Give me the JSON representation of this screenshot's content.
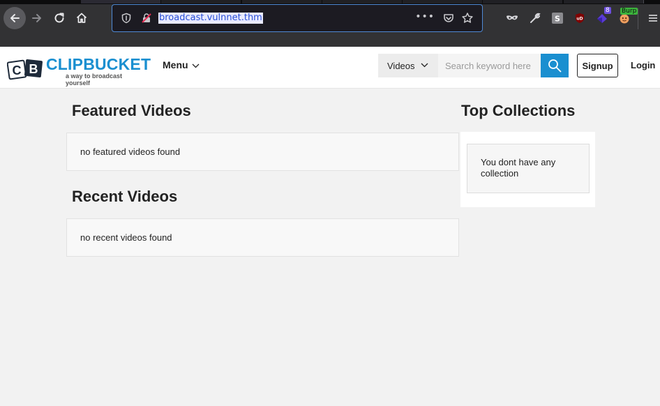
{
  "browser": {
    "url": "broadcast.vulnnet.thm",
    "more_label": "•••",
    "extensions": {
      "badge_count": "8",
      "burp_label": "Burp"
    }
  },
  "site": {
    "brand": "CLIPBUCKET",
    "tagline": "a way to broadcast yourself",
    "logo_letters": "CB",
    "menu_label": "Menu",
    "search": {
      "type_selected": "Videos",
      "placeholder": "Search keyword here"
    },
    "signup_label": "Signup",
    "login_label": "Login",
    "accent_color": "#1a8fd0"
  },
  "main": {
    "featured": {
      "title": "Featured Videos",
      "empty_message": "no featured videos found"
    },
    "recent": {
      "title": "Recent Videos",
      "empty_message": "no recent videos found"
    },
    "collections": {
      "title": "Top Collections",
      "empty_message": "You dont have any collection"
    }
  }
}
